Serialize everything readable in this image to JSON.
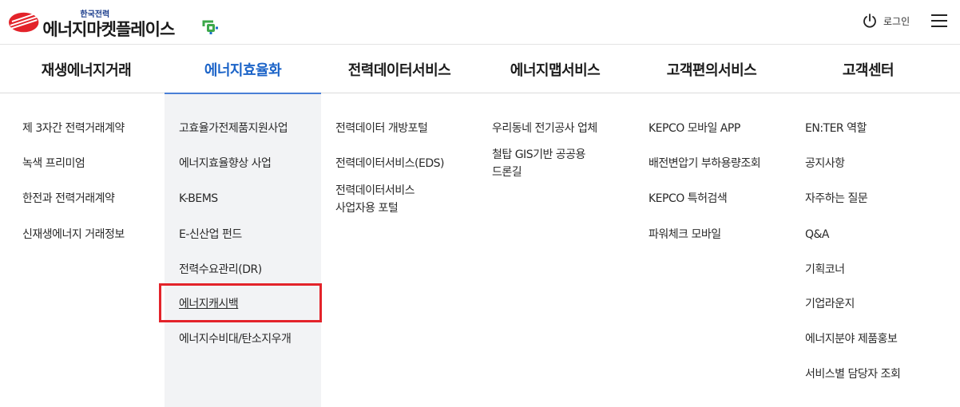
{
  "header": {
    "logo_small": "한국전력",
    "logo_main": "에너지마켓플레이스",
    "login_label": "로그인"
  },
  "icons": {
    "logo": "kepco-logo-icon",
    "plug": "plug-icon",
    "power": "power-icon",
    "menu": "hamburger-menu-icon"
  },
  "colors": {
    "brand_red": "#e3232a",
    "active_blue": "#1c64c8",
    "panel_bg": "#f2f3f5"
  },
  "gnb": [
    {
      "label": "재생에너지거래"
    },
    {
      "label": "에너지효율화",
      "active": true
    },
    {
      "label": "전력데이터서비스"
    },
    {
      "label": "에너지맵서비스"
    },
    {
      "label": "고객편의서비스"
    },
    {
      "label": "고객센터"
    }
  ],
  "columns": [
    [
      "제 3자간 전력거래계약",
      "녹색 프리미엄",
      "한전과 전력거래계약",
      "신재생에너지 거래정보"
    ],
    [
      "고효율가전제품지원사업",
      "에너지효율향상 사업",
      "K-BEMS",
      "E-신산업 펀드",
      "전력수요관리(DR)",
      "에너지캐시백",
      "에너지수비대/탄소지우개"
    ],
    [
      "전력데이터 개방포털",
      "전력데이터서비스(EDS)",
      "전력데이터서비스",
      "사업자용 포털"
    ],
    [
      "우리동네 전기공사 업체",
      "철탑 GIS기반 공공용",
      "드론길"
    ],
    [
      "KEPCO 모바일 APP",
      "배전변압기 부하용량조회",
      "KEPCO 특허검색",
      "파워체크 모바일"
    ],
    [
      "EN:TER 역할",
      "공지사항",
      "자주하는 질문",
      "Q&A",
      "기획코너",
      "기업라운지",
      "에너지분야 제품홍보",
      "서비스별 담당자 조회"
    ]
  ]
}
